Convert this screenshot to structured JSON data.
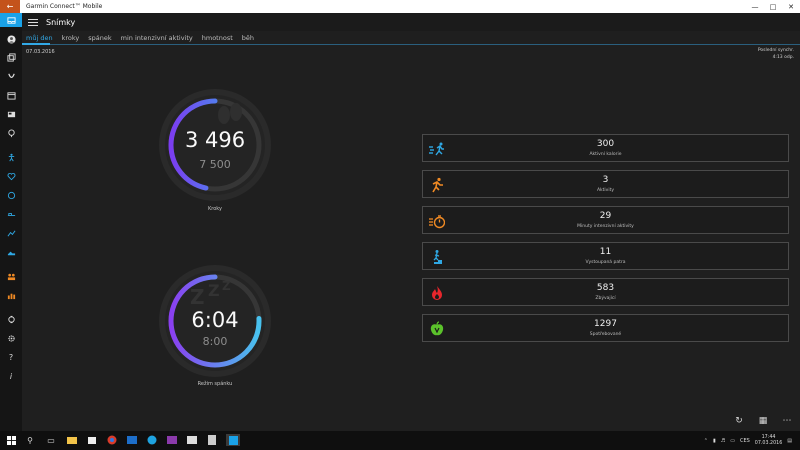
{
  "window": {
    "title": "Garmin Connect™ Mobile"
  },
  "header": {
    "title": "Snímky"
  },
  "tabs": [
    "můj den",
    "kroky",
    "spánek",
    "min intenzivní aktivity",
    "hmotnost",
    "běh"
  ],
  "date": "07.03.2016",
  "sync": {
    "line1": "Poslední synchr.",
    "line2": "4:13 odp."
  },
  "steps_gauge": {
    "value": "3 496",
    "goal": "7 500",
    "label": "Kroky",
    "progress": 0.466,
    "colors": [
      "#2fb5ee",
      "#7b3df0"
    ]
  },
  "sleep_gauge": {
    "value": "6:04",
    "goal": "8:00",
    "label": "Režim spánku",
    "progress": 0.758,
    "colors": [
      "#48c2ee",
      "#8a3ff0"
    ]
  },
  "cards": [
    {
      "icon": "running-fast-icon",
      "value": "300",
      "label": "Aktivní kalorie",
      "color": "#2fa8e4"
    },
    {
      "icon": "running-icon",
      "value": "3",
      "label": "Aktivity",
      "color": "#f08a24"
    },
    {
      "icon": "stopwatch-run-icon",
      "value": "29",
      "label": "Minuty intenzivní aktivity",
      "color": "#f08a24"
    },
    {
      "icon": "stairs-climb-icon",
      "value": "11",
      "label": "Vystoupaná patra",
      "color": "#2fa8e4"
    },
    {
      "icon": "flame-icon",
      "value": "583",
      "label": "Zbývající",
      "color": "#e8262c"
    },
    {
      "icon": "apple-icon",
      "value": "1297",
      "label": "Spotřebované",
      "color": "#5bc22b"
    }
  ],
  "taskbar": {
    "time": "17:44",
    "date": "07.03.2016",
    "lang": "CES"
  }
}
